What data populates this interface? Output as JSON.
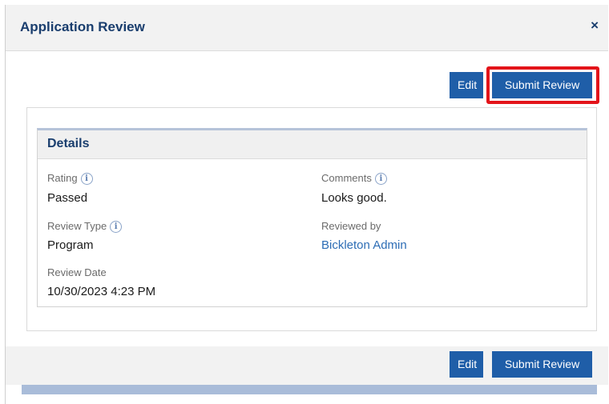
{
  "modal": {
    "title": "Application Review",
    "close_label": "×"
  },
  "toolbar": {
    "edit_label": "Edit",
    "submit_label": "Submit Review"
  },
  "details": {
    "title": "Details",
    "rating_label": "Rating",
    "rating_value": "Passed",
    "comments_label": "Comments",
    "comments_value": "Looks good.",
    "review_type_label": "Review Type",
    "review_type_value": "Program",
    "reviewed_by_label": "Reviewed by",
    "reviewed_by_value": "Bickleton Admin",
    "review_date_label": "Review Date",
    "review_date_value": "10/30/2023 4:23 PM"
  },
  "footer": {
    "edit_label": "Edit",
    "submit_label": "Submit Review"
  },
  "icons": {
    "info": "info-icon",
    "close": "close-icon"
  },
  "colors": {
    "primary_button": "#1f5ea8",
    "title_text": "#1a3e6e",
    "link": "#2d6db5",
    "highlight": "#e3141a"
  }
}
